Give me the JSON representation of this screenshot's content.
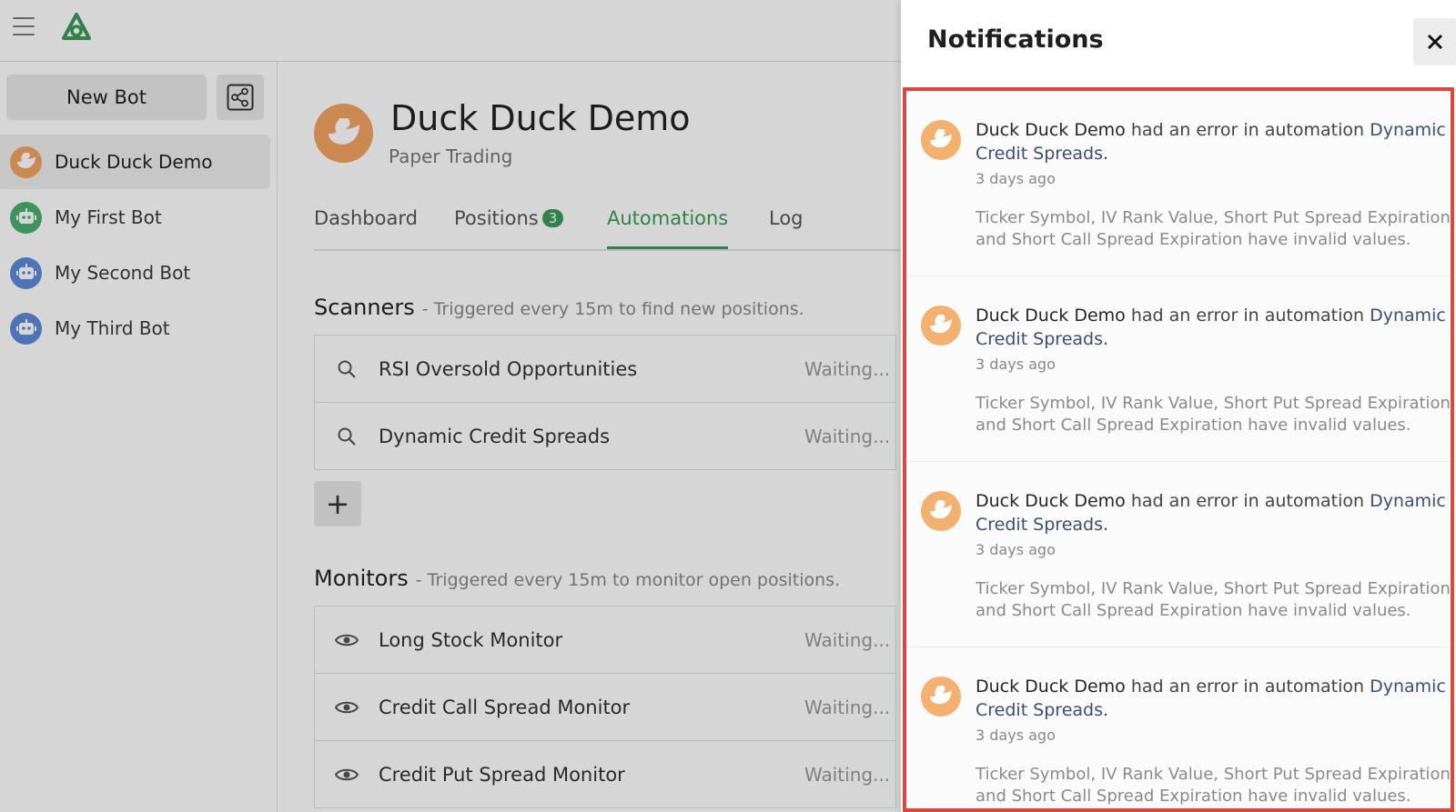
{
  "topbar": {
    "menu_icon": "hamburger-icon",
    "logo_icon": "app-logo"
  },
  "sidebar": {
    "new_bot_label": "New Bot",
    "share_icon": "share-icon",
    "bots": [
      {
        "name": "Duck Duck Demo",
        "icon": "duck-icon",
        "color": "#f4a261",
        "active": true
      },
      {
        "name": "My First Bot",
        "icon": "robot-icon",
        "color": "#4caf6e",
        "active": false
      },
      {
        "name": "My Second Bot",
        "icon": "robot-icon",
        "color": "#5b8bd9",
        "active": false
      },
      {
        "name": "My Third Bot",
        "icon": "robot-icon",
        "color": "#5b8bd9",
        "active": false
      }
    ]
  },
  "main": {
    "title": "Duck Duck Demo",
    "subtitle": "Paper Trading",
    "tabs": [
      {
        "label": "Dashboard"
      },
      {
        "label": "Positions",
        "badge": "3"
      },
      {
        "label": "Automations",
        "active": true
      },
      {
        "label": "Log"
      }
    ],
    "scanners": {
      "title": "Scanners",
      "subtitle": "- Triggered every 15m to find new positions.",
      "items": [
        {
          "label": "RSI Oversold Opportunities",
          "status": "Waiting..."
        },
        {
          "label": "Dynamic Credit Spreads",
          "status": "Waiting..."
        }
      ],
      "add_label": "+"
    },
    "monitors": {
      "title": "Monitors",
      "subtitle": "- Triggered every 15m to monitor open positions.",
      "items": [
        {
          "label": "Long Stock Monitor",
          "status": "Waiting..."
        },
        {
          "label": "Credit Call Spread Monitor",
          "status": "Waiting..."
        },
        {
          "label": "Credit Put Spread Monitor",
          "status": "Waiting..."
        }
      ]
    }
  },
  "notifications": {
    "title": "Notifications",
    "close_icon": "close-icon",
    "items": [
      {
        "bot": "Duck Duck Demo",
        "message": " had an error in automation ",
        "automation": "Dynamic Credit Spreads",
        "time": "3 days ago",
        "detail": "Ticker Symbol, IV Rank Value, Short Put Spread Expiration and Short Call Spread Expiration have invalid values."
      },
      {
        "bot": "Duck Duck Demo",
        "message": " had an error in automation ",
        "automation": "Dynamic Credit Spreads",
        "time": "3 days ago",
        "detail": "Ticker Symbol, IV Rank Value, Short Put Spread Expiration and Short Call Spread Expiration have invalid values."
      },
      {
        "bot": "Duck Duck Demo",
        "message": " had an error in automation ",
        "automation": "Dynamic Credit Spreads",
        "time": "3 days ago",
        "detail": "Ticker Symbol, IV Rank Value, Short Put Spread Expiration and Short Call Spread Expiration have invalid values."
      },
      {
        "bot": "Duck Duck Demo",
        "message": " had an error in automation ",
        "automation": "Dynamic Credit Spreads",
        "time": "3 days ago",
        "detail": "Ticker Symbol, IV Rank Value, Short Put Spread Expiration and Short Call Spread Expiration have invalid values."
      }
    ]
  },
  "colors": {
    "accent_green": "#3a9b57",
    "duck_orange": "#f4a261",
    "highlight_red": "#e0453a"
  }
}
